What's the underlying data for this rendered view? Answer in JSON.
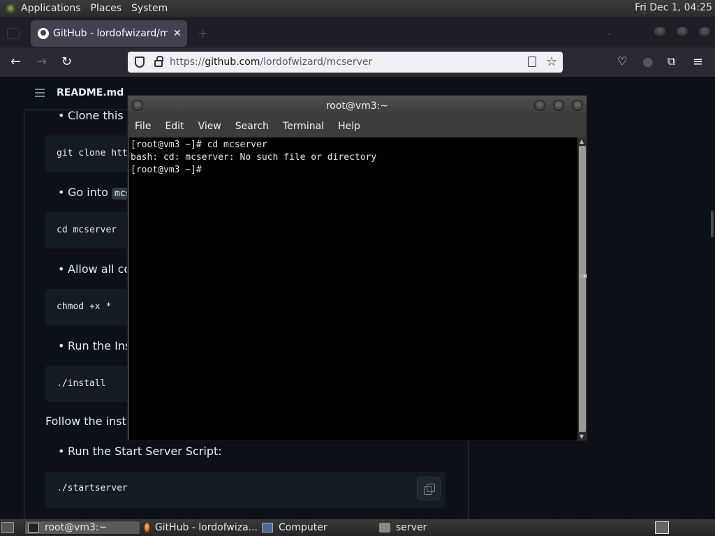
{
  "top_panel": {
    "menus": [
      "Applications",
      "Places",
      "System"
    ],
    "clock": "Fri Dec 1, 04:25"
  },
  "browser": {
    "tab_title": "GitHub - lordofwizard/mcserver",
    "url_prefix": "https://",
    "url_host": "github.com",
    "url_path": "/lordofwizard/mcserver",
    "new_tab_symbol": "+",
    "tab_close_symbol": "✕"
  },
  "readme": {
    "title": "README.md",
    "step1": "Clone this G",
    "code1": "git clone htt",
    "step2_prefix": "Go into ",
    "step2_code": "mcs",
    "code2": "cd mcserver",
    "step3": "Allow all cor",
    "code3": "chmod +x *",
    "step4": "Run the Inst",
    "code4": "./install",
    "para": "Follow the install",
    "step5": "Run the Start Server Script:",
    "code5": "./startserver"
  },
  "terminal": {
    "title": "root@vm3:~",
    "menu": [
      "File",
      "Edit",
      "View",
      "Search",
      "Terminal",
      "Help"
    ],
    "lines": [
      "[root@vm3 ~]# cd mcserver",
      "bash: cd: mcserver: No such file or directory",
      "[root@vm3 ~]#"
    ]
  },
  "taskbar": {
    "items": [
      {
        "label": "root@vm3:~",
        "icon": "terminal-icon"
      },
      {
        "label": "GitHub - lordofwiza...",
        "icon": "firefox-icon"
      },
      {
        "label": "Computer",
        "icon": "computer-icon"
      },
      {
        "label": "server",
        "icon": "folder-icon"
      }
    ]
  }
}
